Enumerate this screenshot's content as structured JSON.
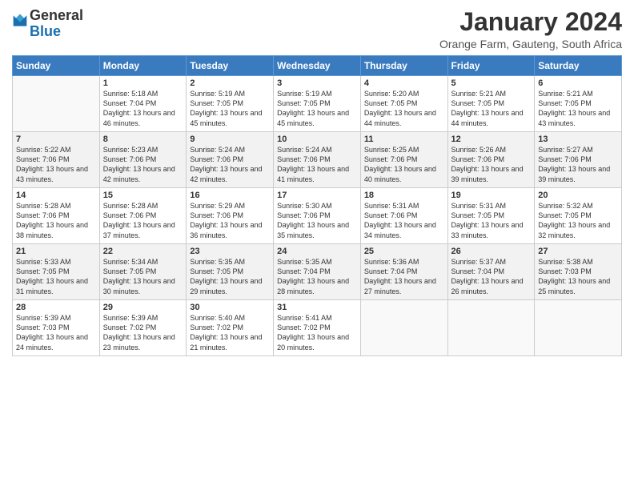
{
  "header": {
    "logo_general": "General",
    "logo_blue": "Blue",
    "month_title": "January 2024",
    "location": "Orange Farm, Gauteng, South Africa"
  },
  "days_of_week": [
    "Sunday",
    "Monday",
    "Tuesday",
    "Wednesday",
    "Thursday",
    "Friday",
    "Saturday"
  ],
  "weeks": [
    [
      {
        "num": "",
        "sunrise": "",
        "sunset": "",
        "daylight": ""
      },
      {
        "num": "1",
        "sunrise": "Sunrise: 5:18 AM",
        "sunset": "Sunset: 7:04 PM",
        "daylight": "Daylight: 13 hours and 46 minutes."
      },
      {
        "num": "2",
        "sunrise": "Sunrise: 5:19 AM",
        "sunset": "Sunset: 7:05 PM",
        "daylight": "Daylight: 13 hours and 45 minutes."
      },
      {
        "num": "3",
        "sunrise": "Sunrise: 5:19 AM",
        "sunset": "Sunset: 7:05 PM",
        "daylight": "Daylight: 13 hours and 45 minutes."
      },
      {
        "num": "4",
        "sunrise": "Sunrise: 5:20 AM",
        "sunset": "Sunset: 7:05 PM",
        "daylight": "Daylight: 13 hours and 44 minutes."
      },
      {
        "num": "5",
        "sunrise": "Sunrise: 5:21 AM",
        "sunset": "Sunset: 7:05 PM",
        "daylight": "Daylight: 13 hours and 44 minutes."
      },
      {
        "num": "6",
        "sunrise": "Sunrise: 5:21 AM",
        "sunset": "Sunset: 7:05 PM",
        "daylight": "Daylight: 13 hours and 43 minutes."
      }
    ],
    [
      {
        "num": "7",
        "sunrise": "Sunrise: 5:22 AM",
        "sunset": "Sunset: 7:06 PM",
        "daylight": "Daylight: 13 hours and 43 minutes."
      },
      {
        "num": "8",
        "sunrise": "Sunrise: 5:23 AM",
        "sunset": "Sunset: 7:06 PM",
        "daylight": "Daylight: 13 hours and 42 minutes."
      },
      {
        "num": "9",
        "sunrise": "Sunrise: 5:24 AM",
        "sunset": "Sunset: 7:06 PM",
        "daylight": "Daylight: 13 hours and 42 minutes."
      },
      {
        "num": "10",
        "sunrise": "Sunrise: 5:24 AM",
        "sunset": "Sunset: 7:06 PM",
        "daylight": "Daylight: 13 hours and 41 minutes."
      },
      {
        "num": "11",
        "sunrise": "Sunrise: 5:25 AM",
        "sunset": "Sunset: 7:06 PM",
        "daylight": "Daylight: 13 hours and 40 minutes."
      },
      {
        "num": "12",
        "sunrise": "Sunrise: 5:26 AM",
        "sunset": "Sunset: 7:06 PM",
        "daylight": "Daylight: 13 hours and 39 minutes."
      },
      {
        "num": "13",
        "sunrise": "Sunrise: 5:27 AM",
        "sunset": "Sunset: 7:06 PM",
        "daylight": "Daylight: 13 hours and 39 minutes."
      }
    ],
    [
      {
        "num": "14",
        "sunrise": "Sunrise: 5:28 AM",
        "sunset": "Sunset: 7:06 PM",
        "daylight": "Daylight: 13 hours and 38 minutes."
      },
      {
        "num": "15",
        "sunrise": "Sunrise: 5:28 AM",
        "sunset": "Sunset: 7:06 PM",
        "daylight": "Daylight: 13 hours and 37 minutes."
      },
      {
        "num": "16",
        "sunrise": "Sunrise: 5:29 AM",
        "sunset": "Sunset: 7:06 PM",
        "daylight": "Daylight: 13 hours and 36 minutes."
      },
      {
        "num": "17",
        "sunrise": "Sunrise: 5:30 AM",
        "sunset": "Sunset: 7:06 PM",
        "daylight": "Daylight: 13 hours and 35 minutes."
      },
      {
        "num": "18",
        "sunrise": "Sunrise: 5:31 AM",
        "sunset": "Sunset: 7:06 PM",
        "daylight": "Daylight: 13 hours and 34 minutes."
      },
      {
        "num": "19",
        "sunrise": "Sunrise: 5:31 AM",
        "sunset": "Sunset: 7:05 PM",
        "daylight": "Daylight: 13 hours and 33 minutes."
      },
      {
        "num": "20",
        "sunrise": "Sunrise: 5:32 AM",
        "sunset": "Sunset: 7:05 PM",
        "daylight": "Daylight: 13 hours and 32 minutes."
      }
    ],
    [
      {
        "num": "21",
        "sunrise": "Sunrise: 5:33 AM",
        "sunset": "Sunset: 7:05 PM",
        "daylight": "Daylight: 13 hours and 31 minutes."
      },
      {
        "num": "22",
        "sunrise": "Sunrise: 5:34 AM",
        "sunset": "Sunset: 7:05 PM",
        "daylight": "Daylight: 13 hours and 30 minutes."
      },
      {
        "num": "23",
        "sunrise": "Sunrise: 5:35 AM",
        "sunset": "Sunset: 7:05 PM",
        "daylight": "Daylight: 13 hours and 29 minutes."
      },
      {
        "num": "24",
        "sunrise": "Sunrise: 5:35 AM",
        "sunset": "Sunset: 7:04 PM",
        "daylight": "Daylight: 13 hours and 28 minutes."
      },
      {
        "num": "25",
        "sunrise": "Sunrise: 5:36 AM",
        "sunset": "Sunset: 7:04 PM",
        "daylight": "Daylight: 13 hours and 27 minutes."
      },
      {
        "num": "26",
        "sunrise": "Sunrise: 5:37 AM",
        "sunset": "Sunset: 7:04 PM",
        "daylight": "Daylight: 13 hours and 26 minutes."
      },
      {
        "num": "27",
        "sunrise": "Sunrise: 5:38 AM",
        "sunset": "Sunset: 7:03 PM",
        "daylight": "Daylight: 13 hours and 25 minutes."
      }
    ],
    [
      {
        "num": "28",
        "sunrise": "Sunrise: 5:39 AM",
        "sunset": "Sunset: 7:03 PM",
        "daylight": "Daylight: 13 hours and 24 minutes."
      },
      {
        "num": "29",
        "sunrise": "Sunrise: 5:39 AM",
        "sunset": "Sunset: 7:02 PM",
        "daylight": "Daylight: 13 hours and 23 minutes."
      },
      {
        "num": "30",
        "sunrise": "Sunrise: 5:40 AM",
        "sunset": "Sunset: 7:02 PM",
        "daylight": "Daylight: 13 hours and 21 minutes."
      },
      {
        "num": "31",
        "sunrise": "Sunrise: 5:41 AM",
        "sunset": "Sunset: 7:02 PM",
        "daylight": "Daylight: 13 hours and 20 minutes."
      },
      {
        "num": "",
        "sunrise": "",
        "sunset": "",
        "daylight": ""
      },
      {
        "num": "",
        "sunrise": "",
        "sunset": "",
        "daylight": ""
      },
      {
        "num": "",
        "sunrise": "",
        "sunset": "",
        "daylight": ""
      }
    ]
  ]
}
